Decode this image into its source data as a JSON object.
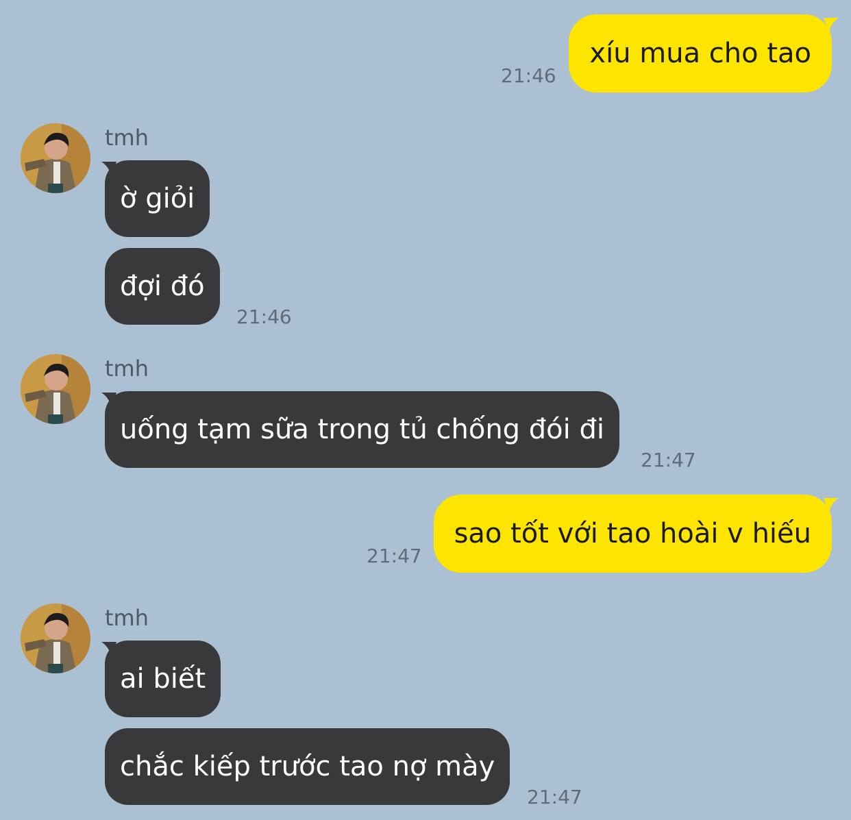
{
  "colors": {
    "background": "#abc0d2",
    "outgoing_bubble": "#fee500",
    "incoming_bubble": "#39393c",
    "timestamp": "#5f6c78"
  },
  "messages": [
    {
      "direction": "out",
      "text": "xíu mua cho tao",
      "time": "21:46"
    },
    {
      "direction": "in",
      "sender": "tmh",
      "avatar_icon": "profile-photo",
      "text": "ờ giỏi"
    },
    {
      "direction": "in",
      "text": "đợi đó",
      "time": "21:46"
    },
    {
      "direction": "in",
      "sender": "tmh",
      "avatar_icon": "profile-photo",
      "text": "uống tạm sữa trong tủ chống đói đi",
      "time": "21:47"
    },
    {
      "direction": "out",
      "text": "sao tốt với tao hoài v hiếu",
      "time": "21:47"
    },
    {
      "direction": "in",
      "sender": "tmh",
      "avatar_icon": "profile-photo",
      "text": "ai biết"
    },
    {
      "direction": "in",
      "text": "chắc kiếp trước tao nợ mày",
      "time": "21:47"
    }
  ]
}
